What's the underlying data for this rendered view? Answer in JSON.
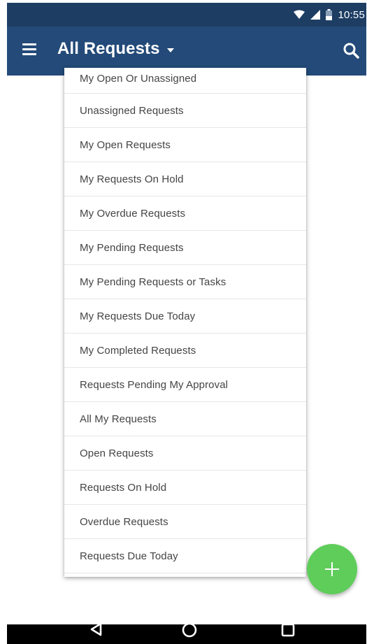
{
  "status_bar": {
    "time": "10:55",
    "icons": [
      "wifi-icon",
      "signal-icon",
      "battery-icon"
    ]
  },
  "app_bar": {
    "title": "All Requests",
    "icons": [
      "menu-icon",
      "dropdown-caret-icon",
      "search-icon"
    ]
  },
  "dropdown": {
    "items": [
      "My Open Or Unassigned",
      "Unassigned Requests",
      "My Open Requests",
      "My Requests On Hold",
      "My Overdue Requests",
      "My Pending Requests",
      "My Pending Requests or Tasks",
      "My Requests Due Today",
      "My Completed Requests",
      "Requests Pending My Approval",
      "All My Requests",
      "Open Requests",
      "Requests On Hold",
      "Overdue Requests",
      "Requests Due Today"
    ]
  },
  "fab": {
    "icon": "plus-icon"
  },
  "nav_bar": {
    "icons": [
      "back-icon",
      "home-icon",
      "recent-apps-icon"
    ]
  },
  "colors": {
    "status_bar": "#1d3d63",
    "app_bar": "#234a78",
    "fab": "#5fcd5a",
    "nav_bar": "#000000",
    "item_text": "#444444"
  }
}
